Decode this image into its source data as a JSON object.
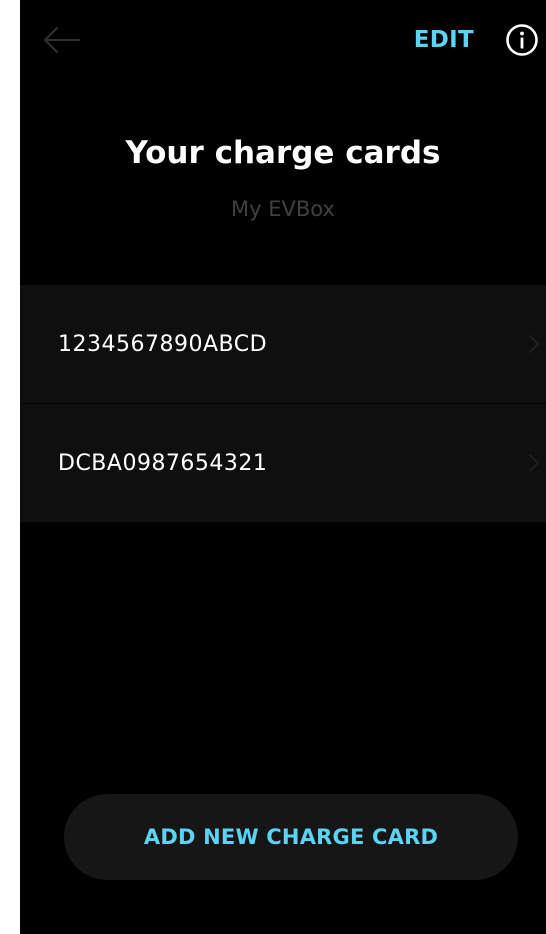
{
  "topbar": {
    "back_icon": "arrow-left-icon",
    "edit_label": "EDIT",
    "info_icon": "info-circle-icon"
  },
  "header": {
    "title": "Your charge cards",
    "subtitle": "My EVBox"
  },
  "cards": [
    {
      "number": "1234567890ABCD",
      "chevron_icon": "chevron-right-icon"
    },
    {
      "number": "DCBA0987654321",
      "chevron_icon": "chevron-right-icon"
    }
  ],
  "add_button": {
    "label": "ADD NEW CHARGE CARD"
  },
  "colors": {
    "background": "#000000",
    "accent": "#5ad3f4",
    "row_background": "#0f0f0f",
    "button_background": "#161616",
    "subtitle": "#404040",
    "text": "#ffffff"
  }
}
